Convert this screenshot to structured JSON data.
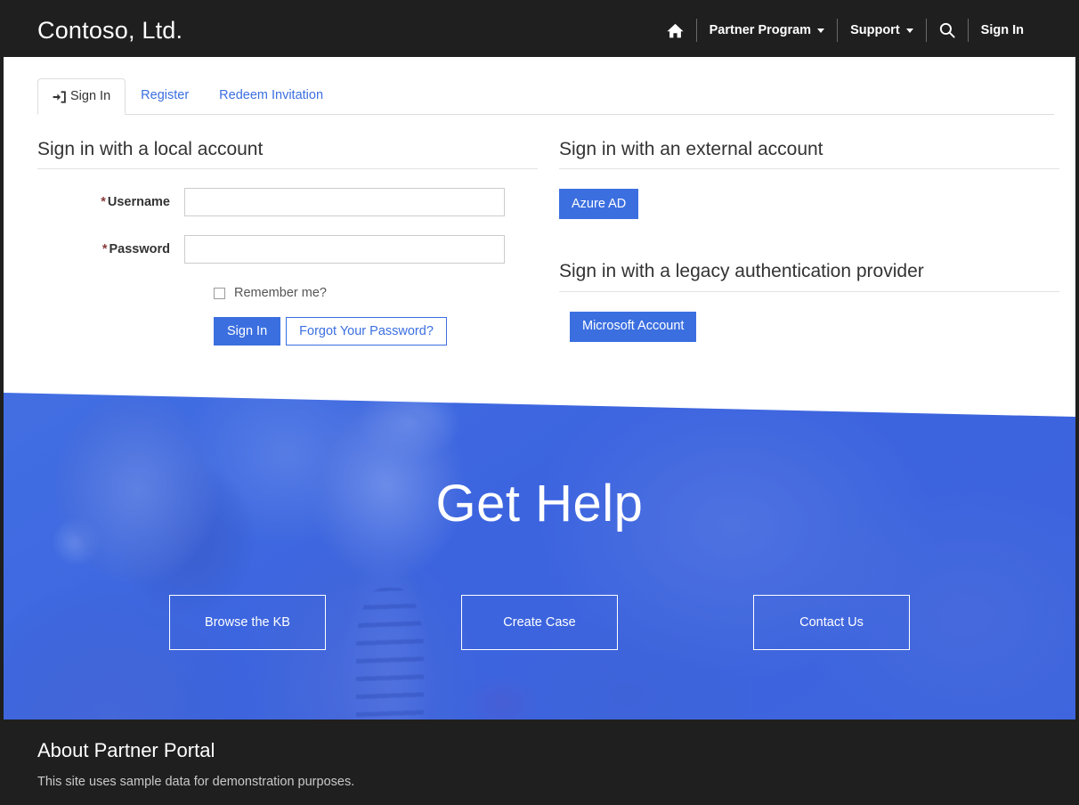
{
  "navbar": {
    "brand": "Contoso, Ltd.",
    "home_icon": "home-icon",
    "search_icon": "search-icon",
    "items": [
      {
        "label": "Partner Program",
        "has_caret": true
      },
      {
        "label": "Support",
        "has_caret": true
      }
    ],
    "sign_in": "Sign In"
  },
  "tabs": [
    {
      "label": "Sign In",
      "active": true,
      "icon": "sign-in-icon"
    },
    {
      "label": "Register",
      "active": false
    },
    {
      "label": "Redeem Invitation",
      "active": false
    }
  ],
  "local": {
    "heading": "Sign in with a local account",
    "username_label": "Username",
    "password_label": "Password",
    "required_marker": "*",
    "username_value": "",
    "password_value": "",
    "remember_label": "Remember me?",
    "remember_checked": false,
    "sign_in_button": "Sign In",
    "forgot_button": "Forgot Your Password?"
  },
  "external": {
    "heading": "Sign in with an external account",
    "providers": [
      "Azure AD"
    ]
  },
  "legacy": {
    "heading": "Sign in with a legacy authentication provider",
    "providers": [
      "Microsoft Account"
    ]
  },
  "hero": {
    "title": "Get Help",
    "buttons": [
      "Browse the KB",
      "Create Case",
      "Contact Us"
    ]
  },
  "footer": {
    "title": "About Partner Portal",
    "subtitle": "This site uses sample data for demonstration purposes."
  },
  "colors": {
    "accent_blue": "#3b6fe0",
    "navbar_dark": "#201f1f",
    "hero_blue": "#4a6fd6",
    "required_red": "#8a3a3a",
    "link_blue": "#3b6fe0"
  }
}
